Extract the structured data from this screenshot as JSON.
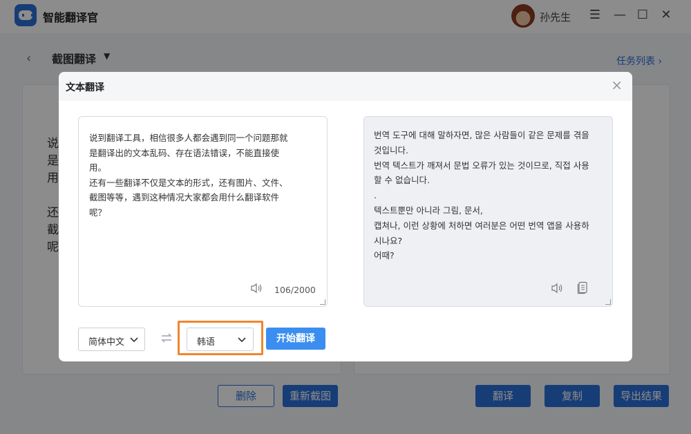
{
  "app": {
    "title": "智能翻译官",
    "user_name": "孙先生"
  },
  "window_controls": {
    "menu": "☰",
    "minimize": "—",
    "maximize": "☐",
    "close": "✕"
  },
  "subheader": {
    "back": "‹",
    "mode": "截图翻译",
    "task_list": "任务列表 ›"
  },
  "background": {
    "text_para1": "说\n是\n用",
    "text_para2": "还\n截\n呢",
    "buttons": {
      "delete": "删除",
      "recapture": "重新截图",
      "translate": "翻译",
      "copy": "复制",
      "export": "导出结果"
    }
  },
  "modal": {
    "title": "文本翻译",
    "close": "×",
    "source_text": "说到翻译工具，相信很多人都会遇到同一个问题那就\n是翻译出的文本乱码、存在语法错误，不能直接使\n用。\n还有一些翻译不仅是文本的形式，还有图片、文件、\n截图等等，遇到这种情况大家都会用什么翻译软件\n呢？",
    "char_count": "106/2000",
    "result_text": "번역 도구에 대해 말하자면, 많은 사람들이 같은 문제를 겪을\n것입니다.\n번역 텍스트가 깨져서 문법 오류가 있는 것이므로, 직접 사용\n할 수 없습니다.\n.\n텍스트뿐만 아니라 그림, 문서,\n캡쳐나, 이런 상황에 처하면 여러분은 어떤 번역 앱을 사용하\n시나요?\n어때?",
    "source_lang": "简体中文",
    "target_lang": "韩语",
    "start_button": "开始翻译"
  },
  "colors": {
    "accent": "#2b6fd8",
    "highlight": "#f0852d",
    "start_button": "#3b8ef0"
  }
}
